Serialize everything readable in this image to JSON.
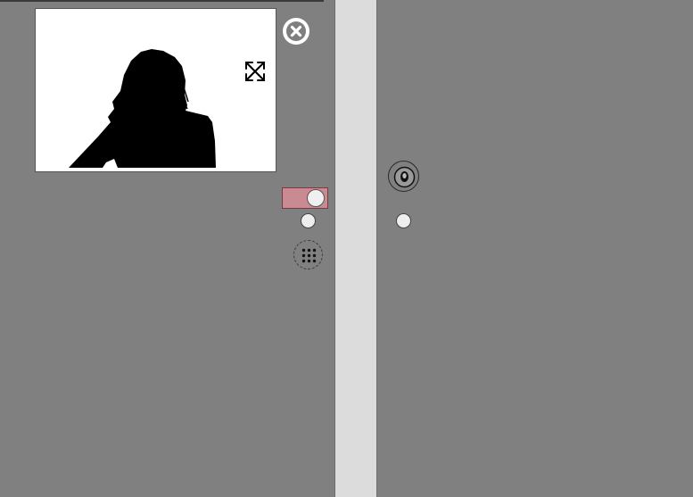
{
  "icons": {
    "close": "close-icon",
    "expand": "expand-icon",
    "dialpad": "dialpad-icon",
    "avatar": "user-avatar-icon"
  },
  "toggle": {
    "state": "on",
    "color": "#c98a92"
  },
  "colors": {
    "background": "#808080",
    "splitter": "#dcdcdc",
    "video_background": "#ffffff"
  }
}
